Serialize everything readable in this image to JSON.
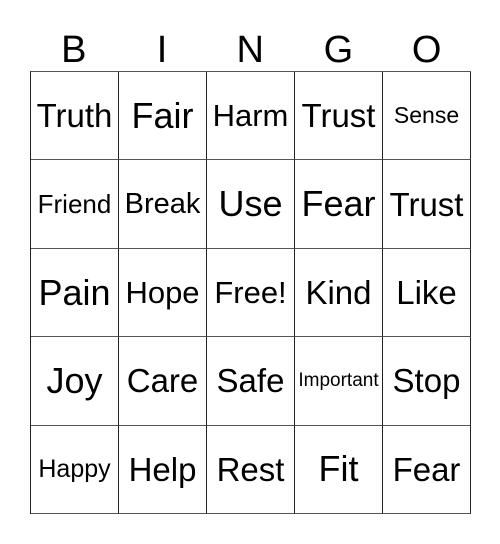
{
  "card": {
    "header": {
      "letters": [
        "B",
        "I",
        "N",
        "G",
        "O"
      ]
    },
    "columns": [
      "B",
      "I",
      "N",
      "G",
      "O"
    ],
    "rows": [
      {
        "cells": [
          {
            "text": "Truth",
            "size": "sz-lg"
          },
          {
            "text": "Fair",
            "size": "sz-xl"
          },
          {
            "text": "Harm",
            "size": "sz-md"
          },
          {
            "text": "Trust",
            "size": "sz-lg"
          },
          {
            "text": "Sense",
            "size": "sz-tiny"
          }
        ]
      },
      {
        "cells": [
          {
            "text": "Friend",
            "size": "sz-xs"
          },
          {
            "text": "Break",
            "size": "sz-sm"
          },
          {
            "text": "Use",
            "size": "sz-xl"
          },
          {
            "text": "Fear",
            "size": "sz-xl"
          },
          {
            "text": "Trust",
            "size": "sz-lg"
          }
        ]
      },
      {
        "cells": [
          {
            "text": "Pain",
            "size": "sz-xl"
          },
          {
            "text": "Hope",
            "size": "sz-md"
          },
          {
            "text": "Free!",
            "size": "sz-md"
          },
          {
            "text": "Kind",
            "size": "sz-lg"
          },
          {
            "text": "Like",
            "size": "sz-lg"
          }
        ]
      },
      {
        "cells": [
          {
            "text": "Joy",
            "size": "sz-xl"
          },
          {
            "text": "Care",
            "size": "sz-lg"
          },
          {
            "text": "Safe",
            "size": "sz-lg"
          },
          {
            "text": "Important",
            "size": "sz-micro"
          },
          {
            "text": "Stop",
            "size": "sz-lg"
          }
        ]
      },
      {
        "cells": [
          {
            "text": "Happy",
            "size": "sz-xxs"
          },
          {
            "text": "Help",
            "size": "sz-lg"
          },
          {
            "text": "Rest",
            "size": "sz-lg"
          },
          {
            "text": "Fit",
            "size": "sz-xl"
          },
          {
            "text": "Fear",
            "size": "sz-lg"
          }
        ]
      }
    ]
  }
}
